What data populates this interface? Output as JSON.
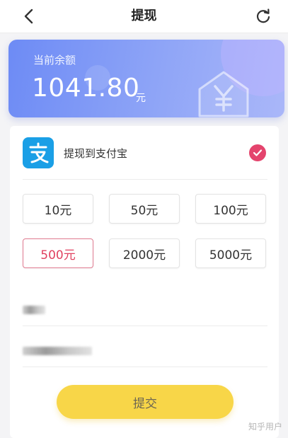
{
  "header": {
    "title": "提现",
    "back_icon": "chevron-left-icon",
    "refresh_icon": "refresh-icon"
  },
  "balance": {
    "label": "当前余额",
    "amount": "1041.80",
    "unit": "元",
    "icon": "yuan-house-icon",
    "gradient_start": "#6d8bf5",
    "gradient_end": "#aab7f9"
  },
  "payment_method": {
    "label": "提现到支付宝",
    "icon": "alipay-icon",
    "selected": true,
    "check_color": "#e4446d"
  },
  "amount_options": [
    {
      "label": "10元",
      "selected": false
    },
    {
      "label": "50元",
      "selected": false
    },
    {
      "label": "100元",
      "selected": false
    },
    {
      "label": "500元",
      "selected": true
    },
    {
      "label": "2000元",
      "selected": false
    },
    {
      "label": "5000元",
      "selected": false
    }
  ],
  "submit": {
    "label": "提交",
    "color": "#f8d648"
  },
  "watermark": "知乎用户"
}
